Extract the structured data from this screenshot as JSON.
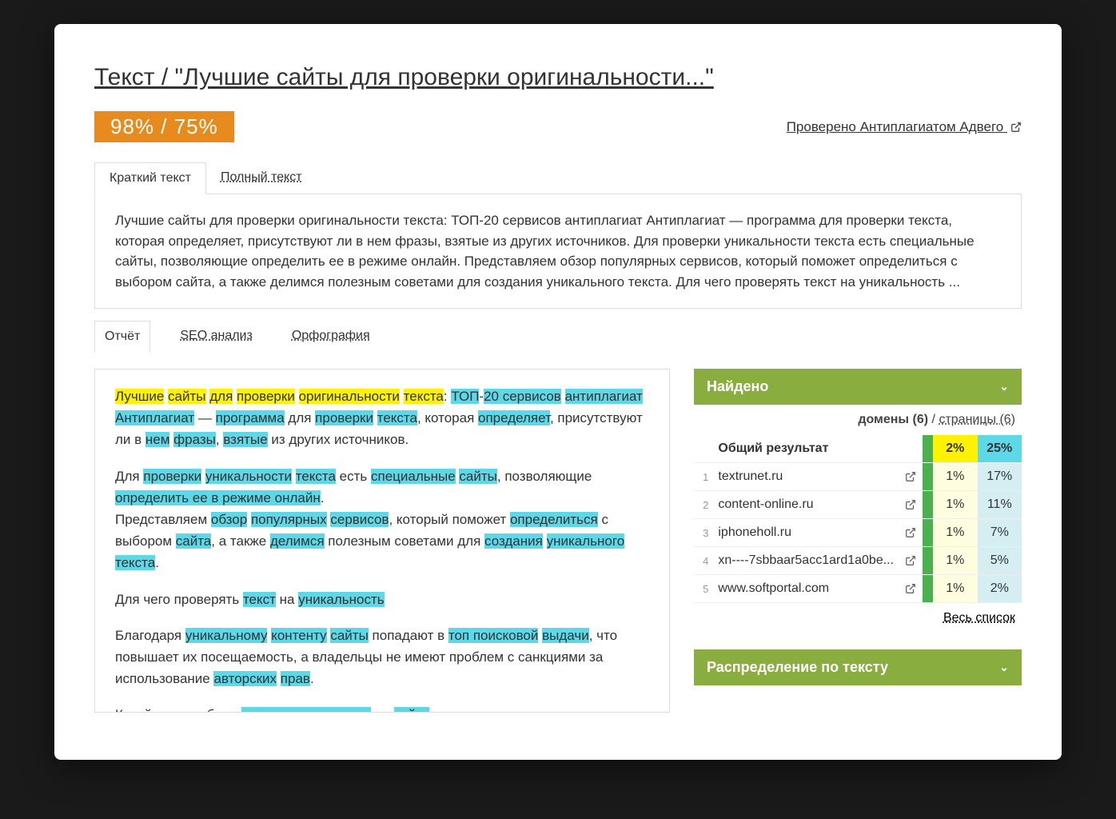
{
  "title": "Текст / \"Лучшие сайты для проверки оригинальности...\"",
  "score": "98% / 75%",
  "checked_by": "Проверено Антиплагиатом Адвего",
  "text_tabs": {
    "short": "Краткий текст",
    "full": "Полный текст"
  },
  "short_text": "Лучшие сайты для проверки оригинальности текста: ТОП-20 сервисов антиплагиат Антиплагиат — программа для проверки текста, которая определяет, присутствуют ли в нем фразы, взятые из других источников. Для проверки уникальности текста есть специальные сайты, позволяющие определить ее в режиме онлайн. Представляем обзор популярных сервисов, который поможет определиться с выбором сайта, а также делимся полезным советами для создания уникального текста. Для чего проверять текст на уникальность ...",
  "report_tabs": {
    "report": "Отчёт",
    "seo": "SEO анализ",
    "spell": "Орфография"
  },
  "found": {
    "header": "Найдено",
    "domains_label": "домены (6)",
    "pages_label": "страницы (6)",
    "total_label": "Общий результат",
    "total_pct1": "2%",
    "total_pct2": "25%",
    "rows": [
      {
        "idx": "1",
        "domain": "textrunet.ru",
        "pct1": "1%",
        "pct2": "17%"
      },
      {
        "idx": "2",
        "domain": "content-online.ru",
        "pct1": "1%",
        "pct2": "11%"
      },
      {
        "idx": "3",
        "domain": "iphoneholl.ru",
        "pct1": "1%",
        "pct2": "7%"
      },
      {
        "idx": "4",
        "domain": "xn----7sbbaar5acc1ard1a0be...",
        "pct1": "1%",
        "pct2": "5%"
      },
      {
        "idx": "5",
        "domain": "www.softportal.com",
        "pct1": "1%",
        "pct2": "2%"
      }
    ],
    "all_list": "Весь список"
  },
  "distribution_header": "Распределение по тексту",
  "highlighted_text": {
    "p1_pre": "",
    "p2_pre": "Для ",
    "p3": "Представляем ",
    "p4_pre": "Для чего проверять ",
    "p5_pre": "Благодаря ",
    "p6_pre": "Какой должна быть "
  }
}
